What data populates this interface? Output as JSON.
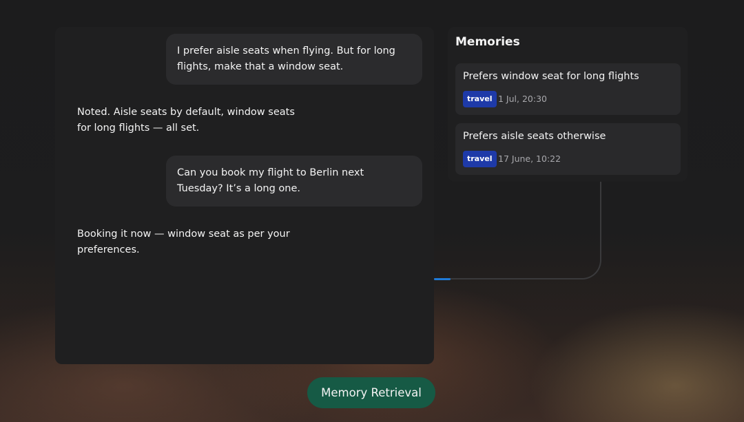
{
  "chat": {
    "messages": [
      {
        "role": "user",
        "text": "I prefer aisle seats when flying. But for long flights, make that a window seat."
      },
      {
        "role": "assistant",
        "text": "Noted. Aisle seats by default, window seats for long flights — all set."
      },
      {
        "role": "user",
        "text": "Can you book my flight to Berlin next Tuesday? It’s a long one."
      },
      {
        "role": "assistant",
        "text": "Booking it now — window seat as per your preferences."
      }
    ]
  },
  "memories": {
    "title": "Memories",
    "items": [
      {
        "text": "Prefers window seat for long flights",
        "tag": "travel",
        "date": "1 Jul, 20:30"
      },
      {
        "text": "Prefers aisle seats otherwise",
        "tag": "travel",
        "date": "17 June, 10:22"
      }
    ]
  },
  "footer": {
    "button_label": "Memory Retrieval"
  },
  "colors": {
    "tag": "#1e3aa8",
    "button": "#165a45",
    "accent": "#1f7bd8"
  }
}
